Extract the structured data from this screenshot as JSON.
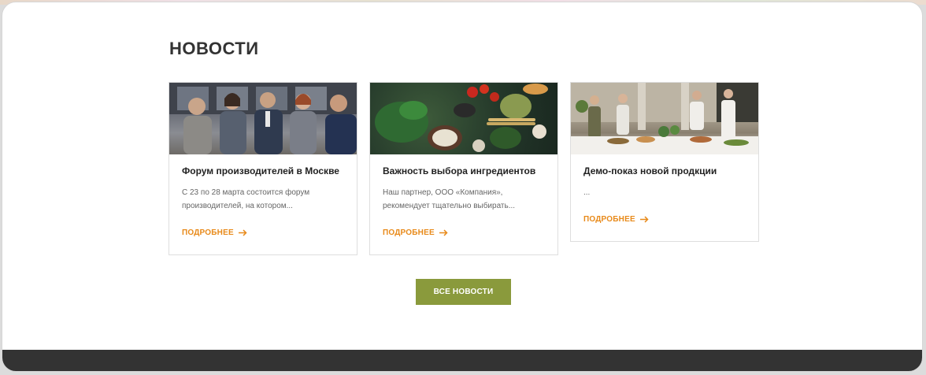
{
  "section": {
    "title": "НОВОСТИ"
  },
  "news": [
    {
      "title": "Форум производителей в Москве",
      "excerpt_line1": "С 23 по 28 марта состоится форум",
      "excerpt_line2": "производителей, на котором...",
      "more": "ПОДРОБНЕЕ",
      "image_icon": "business-meeting-photo"
    },
    {
      "title": "Важность выбора ингредиентов",
      "excerpt_line1": "Наш партнер, ООО «Компания»,",
      "excerpt_line2": "рекомендует тщательно выбирать...",
      "more": "ПОДРОБНЕЕ",
      "image_icon": "ingredients-photo"
    },
    {
      "title": "Демо-показ новой продкции",
      "excerpt_line1": "...",
      "excerpt_line2": "",
      "more": "ПОДРОБНЕЕ",
      "image_icon": "catering-demo-photo"
    }
  ],
  "all_news_button": "ВСЕ НОВОСТИ",
  "colors": {
    "accent_orange": "#e88a1a",
    "button_green": "#8a9a3c",
    "footer": "#333333",
    "title": "#333333"
  }
}
